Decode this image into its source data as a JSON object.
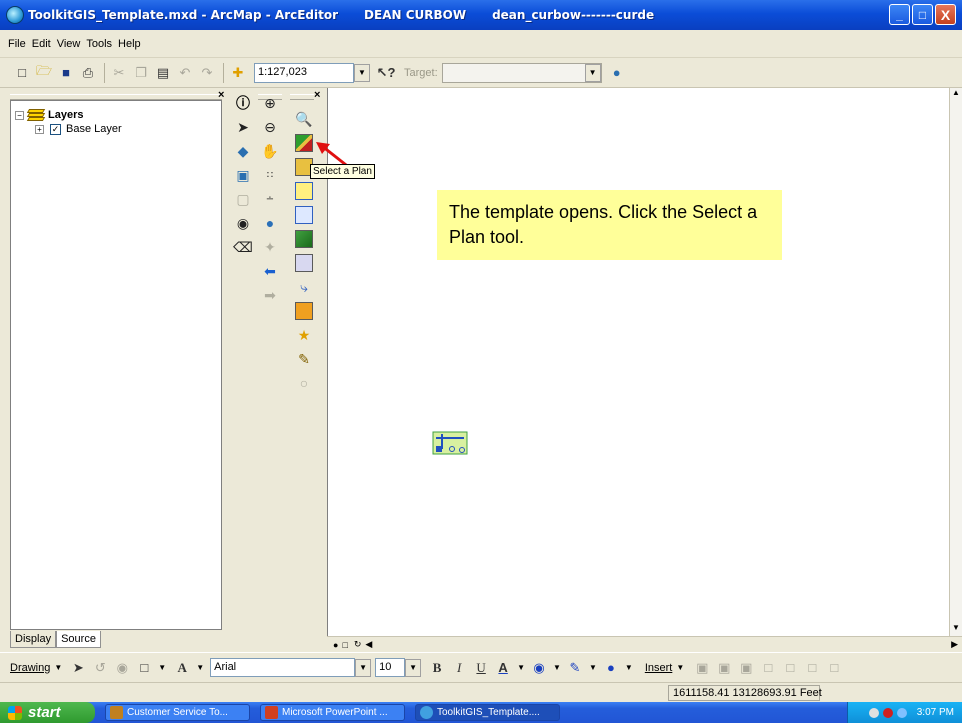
{
  "window": {
    "title": "ToolkitGIS_Template.mxd - ArcMap - ArcEditor",
    "user": "DEAN CURBOW",
    "account": "dean_curbow-------curde",
    "buttons": {
      "minimize": "_",
      "maximize": "□",
      "close": "X"
    }
  },
  "menu": {
    "items": [
      "File",
      "Edit",
      "View",
      "Tools",
      "Help"
    ]
  },
  "toolbar": {
    "scale": "1:127,023",
    "target_label": "Target:",
    "target_value": ""
  },
  "toc": {
    "root": "Layers",
    "layers": [
      {
        "name": "Base Layer",
        "checked": true
      }
    ],
    "tabs": [
      "Display",
      "Source"
    ]
  },
  "tooltip": "Select a Plan",
  "callout": "The template opens. Click the Select a Plan tool.",
  "drawing": {
    "drawing_label": "Drawing",
    "font": "Arial",
    "font_size": "10",
    "insert_label": "Insert"
  },
  "status": {
    "coordinates": "1611158.41  13128693.91 Feet"
  },
  "taskbar": {
    "start": "start",
    "tasks": [
      "Customer Service To...",
      "Microsoft PowerPoint ...",
      "ToolkitGIS_Template...."
    ],
    "clock": "3:07 PM"
  },
  "colors": {
    "callout_bg": "#ffff99",
    "titlebar": "#0b4dd8",
    "taskbar": "#245edb"
  }
}
